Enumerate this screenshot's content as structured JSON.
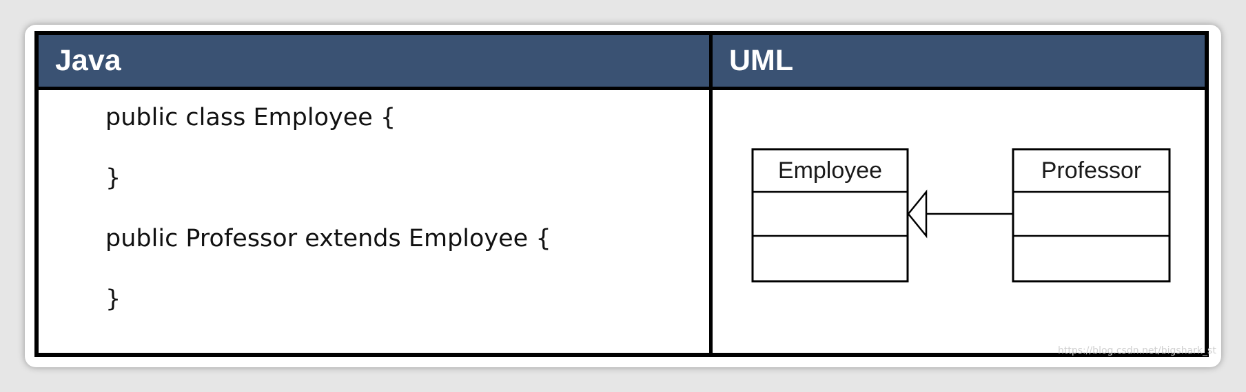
{
  "headers": {
    "java": "Java",
    "uml": "UML"
  },
  "code": {
    "lines": [
      "public class Employee {",
      "}",
      "public Professor extends Employee {",
      "}"
    ]
  },
  "uml": {
    "classes": [
      {
        "name": "Employee"
      },
      {
        "name": "Professor"
      }
    ],
    "relationship": "generalization"
  },
  "watermark": "https://blog.csdn.net/bigshark_st",
  "colors": {
    "header_bg": "#3a5273",
    "header_text": "#ffffff",
    "border": "#000000"
  }
}
